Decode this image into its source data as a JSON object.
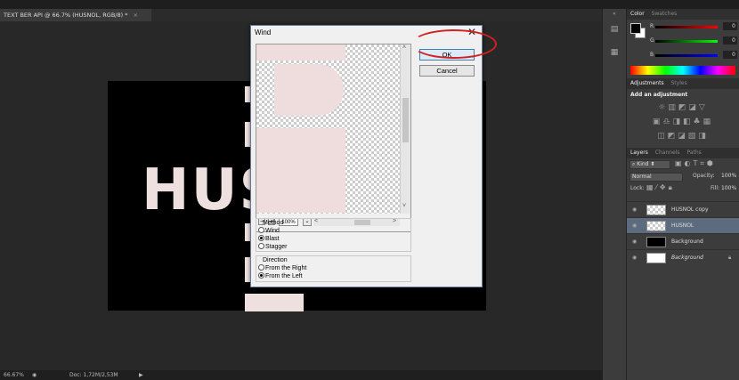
{
  "document": {
    "tab_title": "TEXT BER API @ 66.7% (HUSNOL, RGB/8) *",
    "tab_close": "×",
    "canvas_text": "HUS"
  },
  "status": {
    "zoom": "66.67%",
    "doc": "Doc: 1,72M/2,53M",
    "arrow": "▶"
  },
  "dialog": {
    "title": "Wind",
    "close": "✕",
    "ok_label": "OK",
    "cancel_label": "Cancel",
    "zoom_out": "−",
    "zoom_in": "+",
    "zoom_value": "100%",
    "method": {
      "label": "Method",
      "options": [
        "Wind",
        "Blast",
        "Stagger"
      ],
      "selected": "Blast"
    },
    "direction": {
      "label": "Direction",
      "options": [
        "From the Right",
        "From the Left"
      ],
      "selected": "From the Left"
    }
  },
  "color_panel": {
    "tabs": [
      "Color",
      "Swatches"
    ],
    "channels": [
      {
        "label": "R",
        "value": "0"
      },
      {
        "label": "G",
        "value": "0"
      },
      {
        "label": "B",
        "value": "0"
      }
    ]
  },
  "adjustments_panel": {
    "tabs": [
      "Adjustments",
      "Styles"
    ],
    "heading": "Add an adjustment"
  },
  "layers_panel": {
    "tabs": [
      "Layers",
      "Channels",
      "Paths"
    ],
    "filter_kind": "Kind",
    "blend_mode": "Normal",
    "opacity_label": "Opacity:",
    "opacity": "100%",
    "lock_label": "Lock:",
    "fill_label": "Fill:",
    "fill": "100%",
    "layers": [
      {
        "name": "HUSNOL copy",
        "selected": false
      },
      {
        "name": "HUSNOL",
        "selected": true
      },
      {
        "name": "Background",
        "selected": false
      },
      {
        "name": "Background",
        "selected": false
      }
    ]
  },
  "colors": {
    "annotation": "#d42020",
    "selected_layer": "#5c6b7d",
    "canvas_fill": "#efe0e0"
  }
}
